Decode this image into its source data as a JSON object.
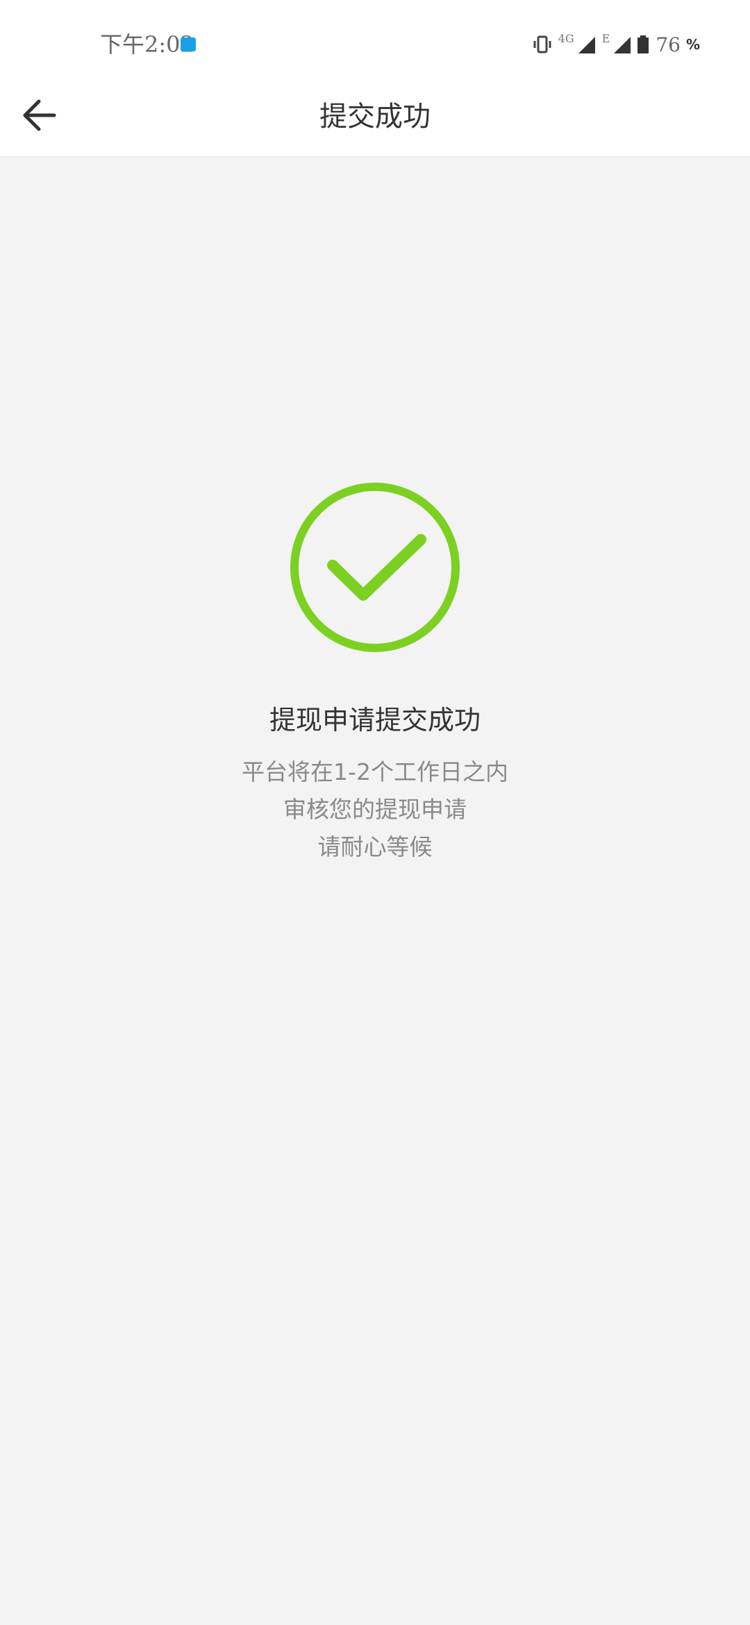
{
  "status_bar": {
    "time": "下午2:02",
    "network_label_1": "4G",
    "network_label_2": "E",
    "battery_level": "76",
    "battery_unit": "%"
  },
  "header": {
    "title": "提交成功"
  },
  "result": {
    "title": "提现申请提交成功",
    "lines": [
      "平台将在1-2个工作日之内",
      "审核您的提现申请",
      "请耐心等候"
    ]
  },
  "colors": {
    "success_green": "#7cd021",
    "background": "#f3f3f3"
  },
  "icons": {
    "back": "arrow-left-icon",
    "success": "check-circle-icon"
  }
}
